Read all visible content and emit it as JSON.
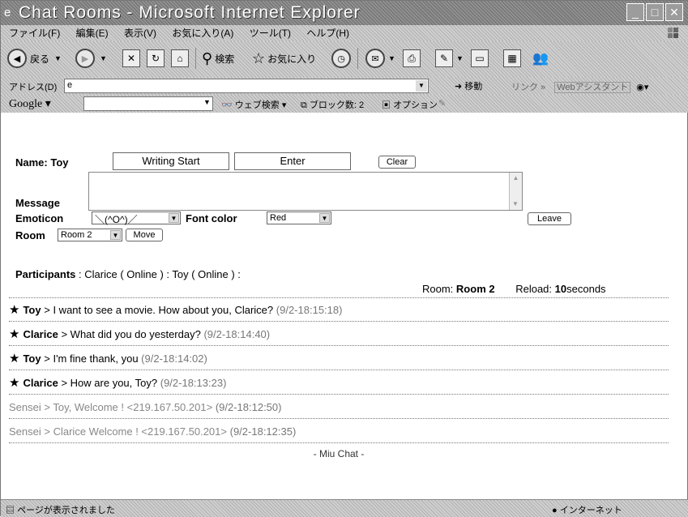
{
  "window": {
    "title": "Chat Rooms - Microsoft Internet Explorer"
  },
  "menu": [
    "ファイル(F)",
    "編集(E)",
    "表示(V)",
    "お気に入り(A)",
    "ツール(T)",
    "ヘルプ(H)"
  ],
  "toolbar": {
    "back_label": "戻る",
    "search_label": "検索",
    "favorites_label": "お気に入り"
  },
  "address": {
    "label": "アドレス(D)",
    "value": "",
    "go_label": "移動",
    "links_label": "リンク",
    "assistant_label": "Webアシスタント"
  },
  "google_toolbar": {
    "logo": "Google",
    "web_search_label": "ウェブ検索",
    "popup_block_label": "ブロック数: 2",
    "options_label": "オプション"
  },
  "chat": {
    "name_label": "Name:",
    "name_value": "Toy",
    "writing_start_label": "Writing Start",
    "enter_label": "Enter",
    "clear_label": "Clear",
    "message_label": "Message",
    "emoticon_label": "Emoticon",
    "emoticon_value": "＼(^O^)／",
    "font_color_label": "Font color",
    "font_color_value": "Red",
    "leave_label": "Leave",
    "room_label": "Room",
    "room_value": "Room 2",
    "move_label": "Move",
    "participants_label": "Participants",
    "participants_text": ": Clarice ( Online ) : Toy ( Online ) :",
    "room_info_label": "Room:",
    "room_info_value": "Room 2",
    "reload_label": "Reload:",
    "reload_value": "10",
    "reload_unit": "seconds",
    "messages": [
      {
        "star": "★",
        "user": "Toy",
        "arrow": ">",
        "text": "I want to see a movie. How about you, Clarice?",
        "time": "(9/2-18:15:18)",
        "style": "normal"
      },
      {
        "star": "★",
        "user": "Clarice",
        "arrow": ">",
        "text": "What did you do yesterday?",
        "time": "(9/2-18:14:40)",
        "style": "normal"
      },
      {
        "star": "★",
        "user": "Toy",
        "arrow": ">",
        "text": "I'm fine thank, you",
        "time": "(9/2-18:14:02)",
        "style": "normal"
      },
      {
        "star": "★",
        "user": "Clarice",
        "arrow": ">",
        "text": "How are you, Toy?",
        "time": "(9/2-18:13:23)",
        "style": "normal"
      },
      {
        "star": "",
        "user": "Sensei",
        "arrow": ">",
        "text": "Toy, Welcome ! <219.167.50.201>",
        "time": "(9/2-18:12:50)",
        "style": "faded"
      },
      {
        "star": "",
        "user": "Sensei",
        "arrow": ">",
        "text": "Clarice Welcome ! <219.167.50.201>",
        "time": "(9/2-18:12:35)",
        "style": "faded"
      }
    ],
    "footer": "- Miu Chat -"
  },
  "status": {
    "text": "ページが表示されました",
    "zone": "インターネット"
  }
}
